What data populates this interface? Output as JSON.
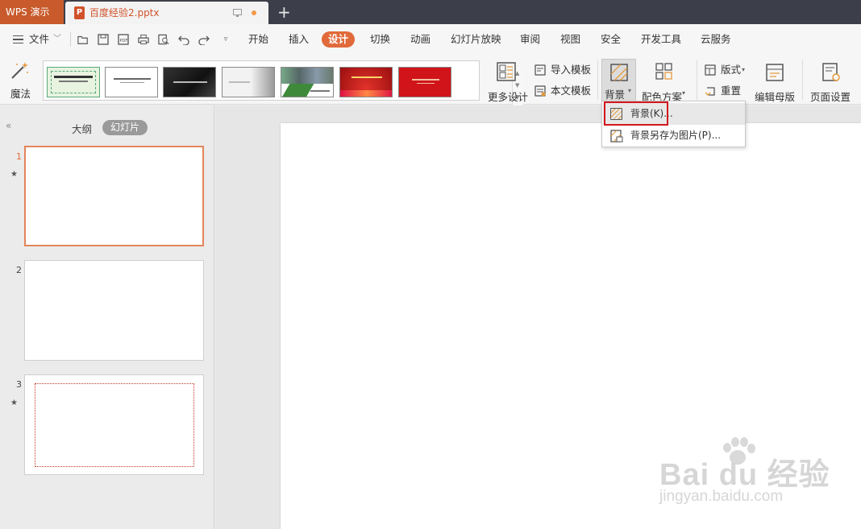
{
  "titlebar": {
    "app_name": "WPS 演示",
    "document_name": "百度经验2.pptx",
    "file_icon_letter": "P",
    "new_tab": "+"
  },
  "menu": {
    "file": "文件",
    "tabs": [
      "开始",
      "插入",
      "设计",
      "切换",
      "动画",
      "幻灯片放映",
      "审阅",
      "视图",
      "安全",
      "开发工具",
      "云服务"
    ],
    "active_tab": "设计"
  },
  "ribbon": {
    "magic": "魔法",
    "more_design": "更多设计",
    "import_template": "导入模板",
    "this_template": "本文模板",
    "background": "背景",
    "color_scheme": "配色方案",
    "layout": "版式",
    "reset": "重置",
    "edit_master": "编辑母版",
    "page_setup": "页面设置"
  },
  "dropdown": {
    "items": [
      "背景(K)...",
      "背景另存为图片(P)..."
    ]
  },
  "left_panel": {
    "tab_outline": "大纲",
    "tab_slides": "幻灯片",
    "slides": [
      {
        "number": "1",
        "star": "★"
      },
      {
        "number": "2",
        "star": ""
      },
      {
        "number": "3",
        "star": "★"
      }
    ]
  },
  "watermark": {
    "main": "Bai du 经验",
    "sub": "jingyan.baidu.com"
  },
  "colors": {
    "accent": "#e16a3a",
    "titlebar": "#3c3f4a",
    "app_tab": "#c85a2b",
    "highlight": "#d3171c"
  }
}
